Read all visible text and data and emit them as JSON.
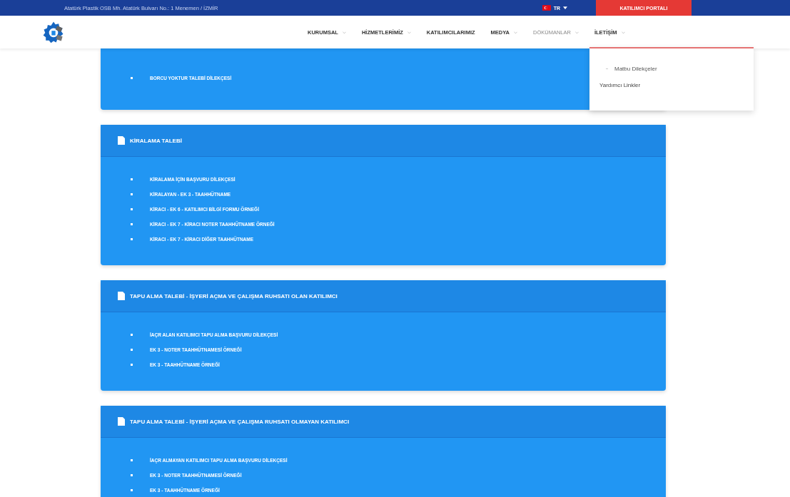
{
  "top_bar": {
    "address": "Atatürk Plastik OSB Mh. Atatürk Bulvarı No.: 1 Menemen / İZMİR",
    "language": "TR",
    "portal_button": "KATILIMCI PORTALI"
  },
  "nav": [
    {
      "label": "KURUMSAL",
      "dropdown": true,
      "selected": false
    },
    {
      "label": "HİZMETLERİMİZ",
      "dropdown": true,
      "selected": false
    },
    {
      "label": "KATILIMCILARIMIZ",
      "dropdown": false,
      "selected": false
    },
    {
      "label": "MEDYA",
      "dropdown": true,
      "selected": false
    },
    {
      "label": "DÖKÜMANLAR",
      "dropdown": true,
      "selected": true
    },
    {
      "label": "İLETİŞİM",
      "dropdown": true,
      "selected": false
    }
  ],
  "dropdown_menu": [
    {
      "label": "Matbu Dilekçeler",
      "selected": true
    },
    {
      "label": "Yardımcı Linkler",
      "selected": false
    }
  ],
  "sections": [
    {
      "items": [
        "BORCU YOKTUR TALEBİ DİLEKÇESİ"
      ]
    },
    {
      "title": "KİRALAMA TALEBİ",
      "items": [
        "KİRALAMA İÇİN BAŞVURU DİLEKÇESİ",
        "KİRALAYAN - EK 3 - TAAHHÜTNAME",
        "KİRACI - EK 6 - KATILIMCI BİLGİ FORMU ÖRNEĞİ",
        "KİRACI - EK 7 - KİRACI NOTER TAAHHÜTNAME ÖRNEĞİ",
        "KİRACI - EK 7 - KİRACI DİĞER TAAHHÜTNAME"
      ]
    },
    {
      "title": "TAPU ALMA TALEBİ - İŞYERİ AÇMA VE ÇALIŞMA RUHSATI OLAN KATILIMCI",
      "items": [
        "İAÇR ALAN KATILIMCI TAPU ALMA BAŞVURU DİLEKÇESİ",
        "EK 3 - NOTER TAAHHÜTNAMESİ ÖRNEĞİ",
        "EK 3 - TAAHHÜTNAME ÖRNEĞİ"
      ]
    },
    {
      "title": "TAPU ALMA TALEBİ - İŞYERİ AÇMA VE ÇALIŞMA RUHSATI OLMAYAN KATILIMCI",
      "items": [
        "İAÇR ALMAYAN KATILIMCI TAPU ALMA BAŞVURU DİLEKÇESİ",
        "EK 3 - NOTER TAAHHÜTNAMESİ ÖRNEĞİ",
        "EK 3 - TAAHHÜTNAME ÖRNEĞİ"
      ]
    }
  ]
}
